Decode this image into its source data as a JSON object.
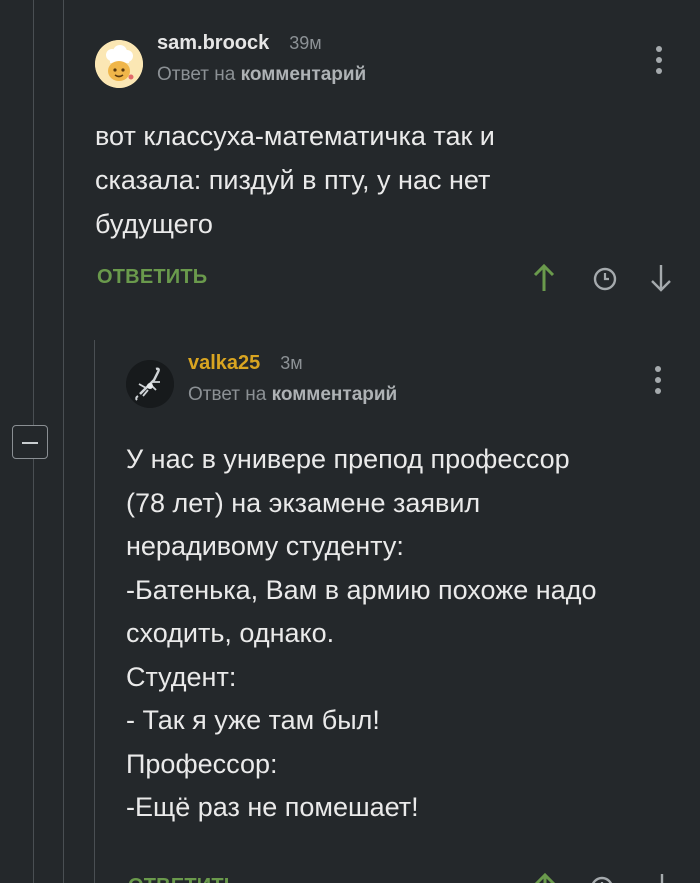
{
  "colors": {
    "background": "#24282b",
    "accent_green": "#6a9a4c",
    "username_gold": "#d9a521",
    "muted": "#8c9195"
  },
  "comments": [
    {
      "username": "sam.broock",
      "time": "39м",
      "reply_prefix": "Ответ на",
      "reply_link": "комментарий",
      "body": "вот классуха-математичка так и\nсказала: пиздуй в пту, у нас нет\nбудущего",
      "reply_button": "ОТВЕТИТЬ",
      "avatar_icon": "chef-hat-avatar-icon",
      "upvote_icon": "arrow-up-icon",
      "history_icon": "clock-icon",
      "downvote_icon": "arrow-down-icon",
      "menu_icon": "kebab-menu-icon"
    },
    {
      "username": "valka25",
      "time": "3м",
      "reply_prefix": "Ответ на",
      "reply_link": "комментарий",
      "body": "У нас в универе препод профессор\n(78 лет) на экзамене заявил\nнерадивому студенту:\n-Батенька, Вам в армию похоже надо\nсходить, однако.\nСтудент:\n- Так я уже там был!\nПрофессор:\n-Ещё раз не помешает!",
      "reply_button": "ОТВЕТИТЬ",
      "avatar_icon": "scorpion-avatar-icon",
      "upvote_icon": "arrow-up-icon",
      "history_icon": "clock-icon",
      "downvote_icon": "arrow-down-icon",
      "menu_icon": "kebab-menu-icon"
    }
  ],
  "thread": {
    "collapse_icon": "minus-icon"
  }
}
